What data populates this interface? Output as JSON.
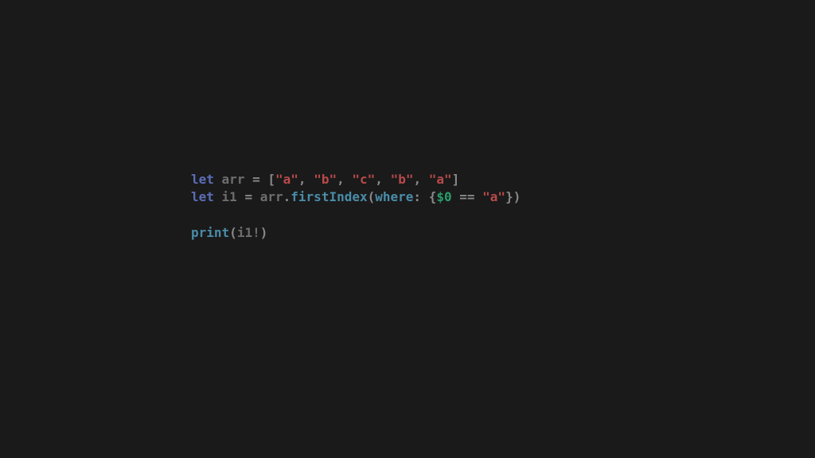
{
  "code": {
    "line1": {
      "let": "let",
      "space1": " ",
      "arr": "arr",
      "space2": " ",
      "equals": "=",
      "space3": " ",
      "lbracket": "[",
      "str1": "\"a\"",
      "comma1": ",",
      "space4": " ",
      "str2": "\"b\"",
      "comma2": ",",
      "space5": " ",
      "str3": "\"c\"",
      "comma3": ",",
      "space6": " ",
      "str4": "\"b\"",
      "comma4": ",",
      "space7": " ",
      "str5": "\"a\"",
      "rbracket": "]"
    },
    "line2": {
      "let": "let",
      "space1": " ",
      "i1": "i1",
      "space2": " ",
      "equals": "=",
      "space3": " ",
      "arr": "arr",
      "dot": ".",
      "firstIndex": "firstIndex",
      "lparen": "(",
      "whereLabel": "where",
      "colon": ":",
      "space4": " ",
      "lbrace": "{",
      "dollar0": "$0",
      "space5": " ",
      "eqeq": "==",
      "space6": " ",
      "strA": "\"a\"",
      "rbrace": "}",
      "rparen": ")"
    },
    "line4": {
      "print": "print",
      "lparen": "(",
      "i1bang": "i1!",
      "rparen": ")"
    }
  }
}
